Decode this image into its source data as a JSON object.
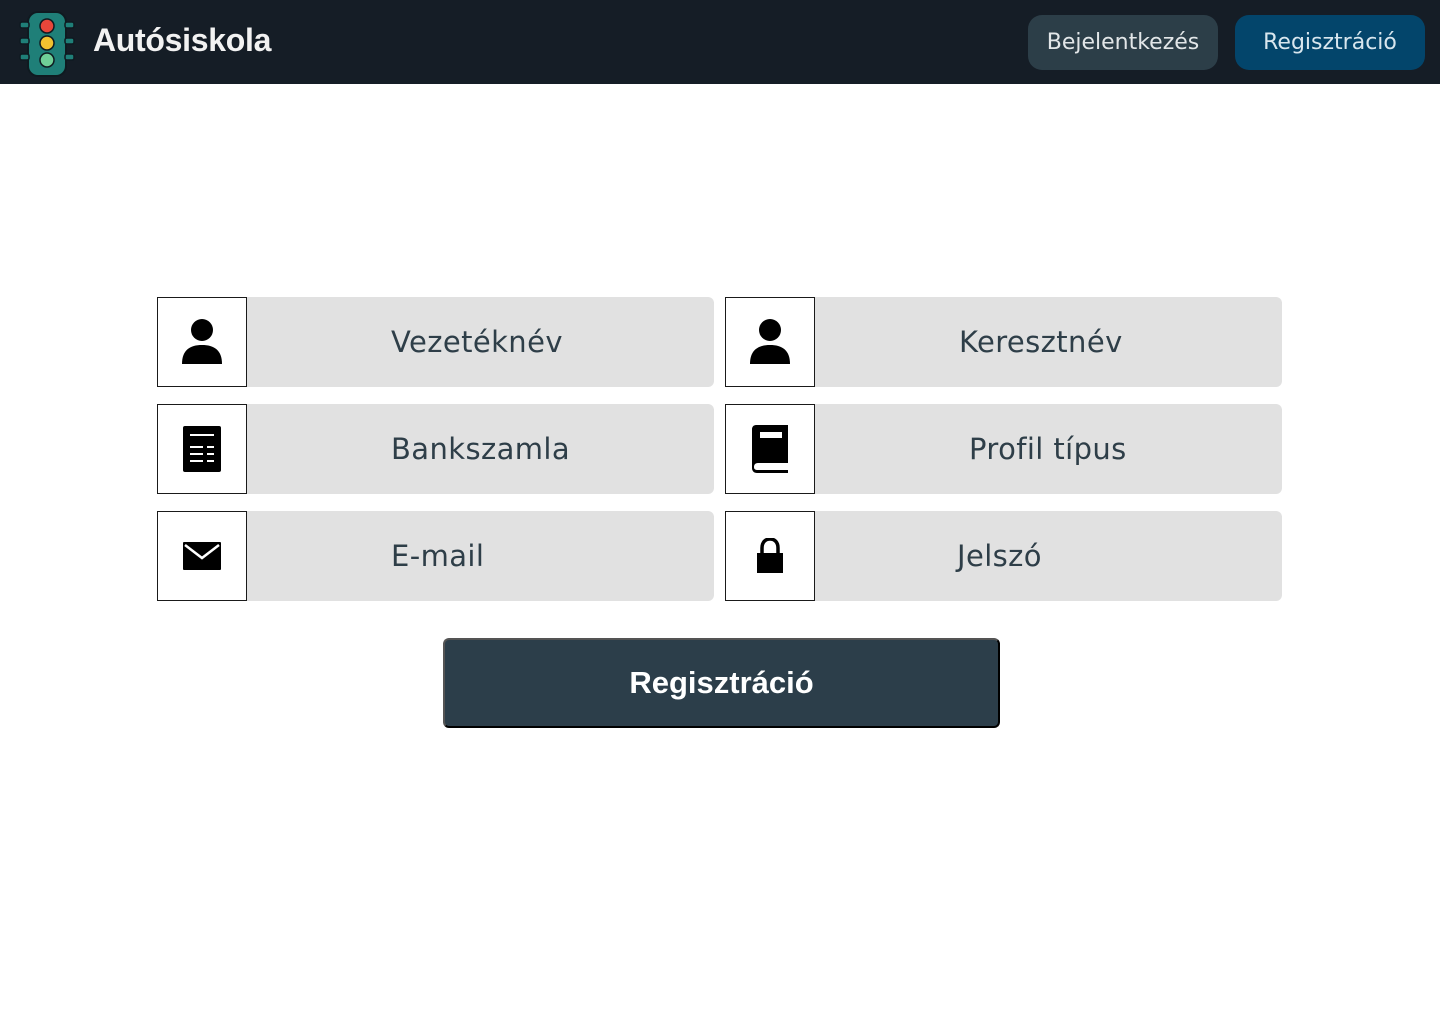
{
  "header": {
    "brand": "Autósiskola",
    "logo_icon": "traffic-light-icon",
    "login_label": "Bejelentkezés",
    "register_label": "Regisztráció"
  },
  "form": {
    "fields": [
      {
        "label": "Vezetéknév",
        "icon": "user-icon"
      },
      {
        "label": "Keresztnév",
        "icon": "user-icon"
      },
      {
        "label": "Bankszamla",
        "icon": "receipt-icon"
      },
      {
        "label": "Profil típus",
        "icon": "book-icon"
      },
      {
        "label": "E-mail",
        "icon": "envelope-icon"
      },
      {
        "label": "Jelszó",
        "icon": "lock-icon"
      }
    ],
    "submit_label": "Regisztráció"
  },
  "colors": {
    "navbar": "#151d26",
    "login_button": "#2c3e48",
    "register_button": "#03456b",
    "field_background": "#e1e1e1",
    "submit_button": "#2c3e4a",
    "text": "#2e3e48"
  }
}
